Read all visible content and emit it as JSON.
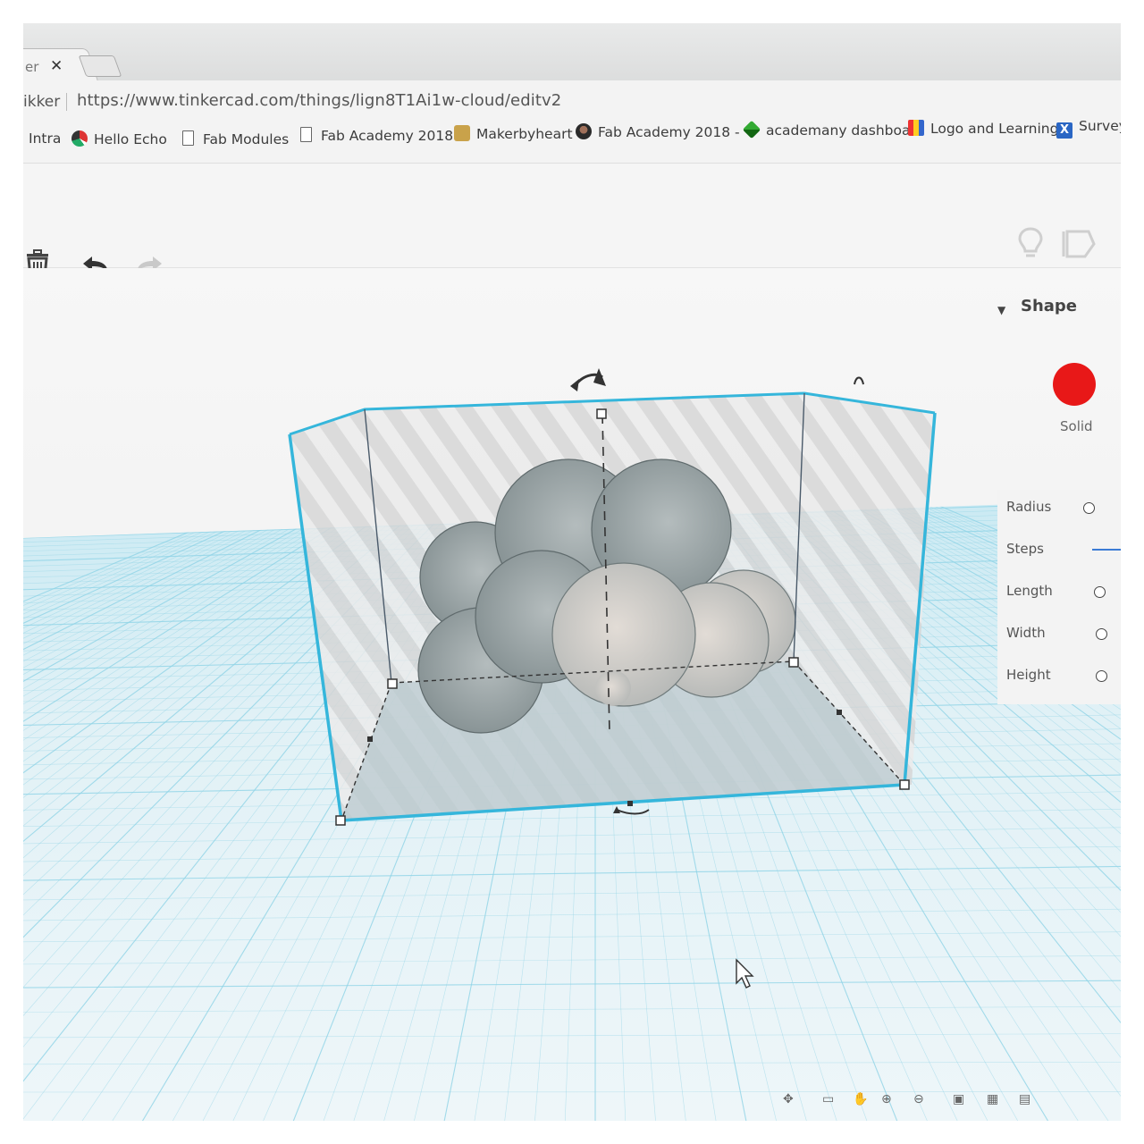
{
  "browser": {
    "tab": {
      "title_fragment": "er",
      "close_glyph": "✕"
    },
    "address": {
      "site_label": "ikker",
      "url": "https://www.tinkercad.com/things/lign8T1Ai1w-cloud/editv2"
    },
    "bookmarks": [
      {
        "label": "Intra",
        "icon": "none"
      },
      {
        "label": "Hello Echo",
        "icon": "cube-icon"
      },
      {
        "label": "Fab Modules",
        "icon": "page-icon"
      },
      {
        "label": "Fab Academy 2018",
        "icon": "page-icon"
      },
      {
        "label": "Makerbyheart",
        "icon": "maker-icon"
      },
      {
        "label": "Fab Academy 2018 -",
        "icon": "avatar-icon"
      },
      {
        "label": "academany dashboa",
        "icon": "gem-icon"
      },
      {
        "label": "Logo and Learning",
        "icon": "logo-icon"
      },
      {
        "label": "Survey",
        "icon": "x-icon"
      }
    ]
  },
  "toolbar": {
    "delete_icon": "trash-icon",
    "undo_icon": "undo-arrow-icon",
    "redo_icon": "redo-arrow-icon",
    "hint_icon": "lightbulb-icon",
    "notes_icon": "note-icon"
  },
  "inspector": {
    "title": "Shape",
    "color": "#e81818",
    "color_label": "Solid",
    "properties": [
      {
        "label": "Radius",
        "control": "radio"
      },
      {
        "label": "Steps",
        "control": "slider"
      },
      {
        "label": "Length",
        "control": "radio"
      },
      {
        "label": "Width",
        "control": "radio"
      },
      {
        "label": "Height",
        "control": "radio"
      }
    ]
  },
  "workspace": {
    "object": "cloud",
    "selection_color": "#35b6db",
    "grid_color": "#8fd3e6"
  }
}
